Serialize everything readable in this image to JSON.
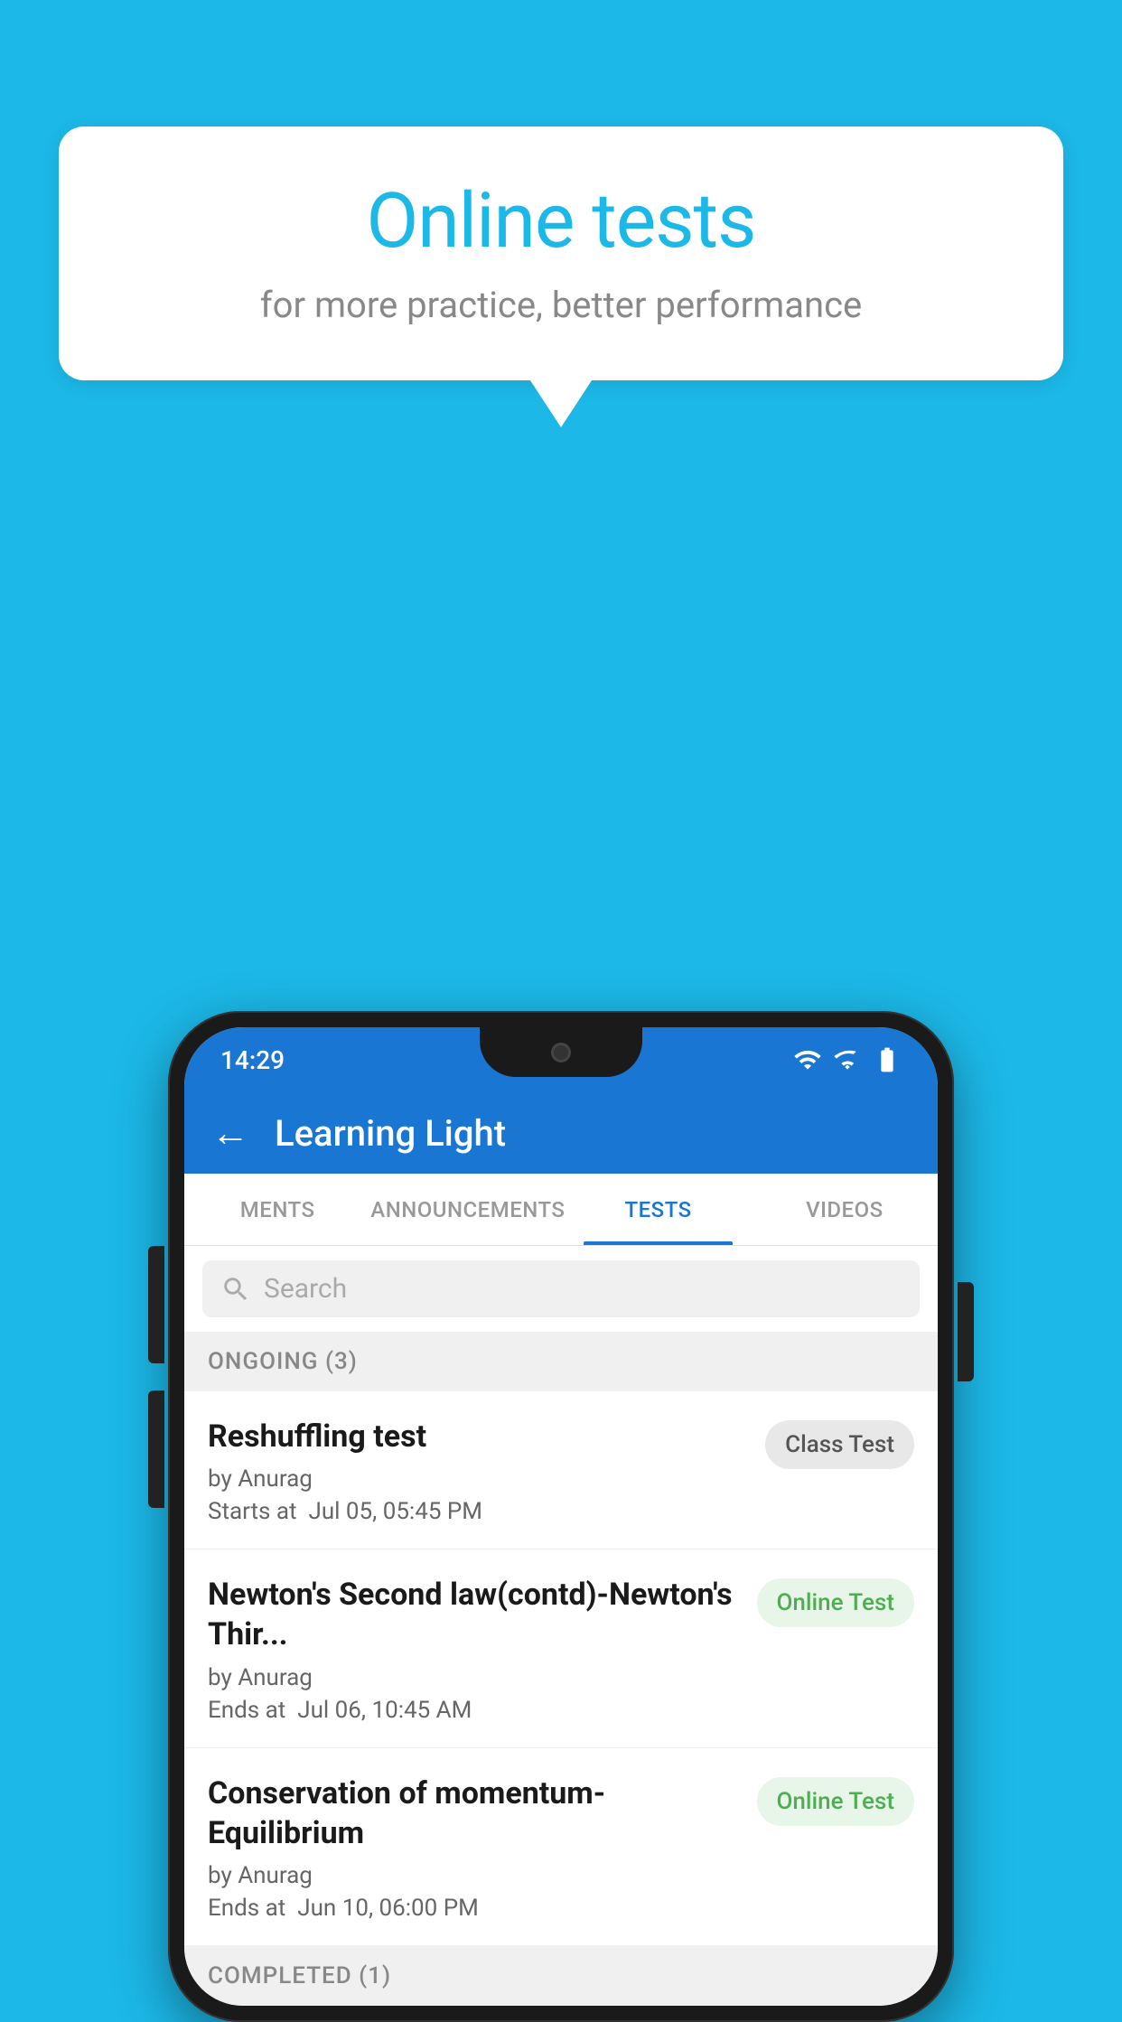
{
  "background": {
    "color": "#1cb8e8"
  },
  "bubble": {
    "title": "Online tests",
    "subtitle": "for more practice, better performance"
  },
  "status_bar": {
    "time": "14:29",
    "wifi_icon": "wifi-icon",
    "signal_icon": "signal-icon",
    "battery_icon": "battery-icon"
  },
  "app_header": {
    "back_label": "←",
    "title": "Learning Light"
  },
  "tabs": [
    {
      "label": "MENTS",
      "active": false
    },
    {
      "label": "ANNOUNCEMENTS",
      "active": false
    },
    {
      "label": "TESTS",
      "active": true
    },
    {
      "label": "VIDEOS",
      "active": false
    }
  ],
  "search": {
    "placeholder": "Search"
  },
  "ongoing_section": {
    "label": "ONGOING (3)"
  },
  "tests": [
    {
      "name": "Reshuffling test",
      "author": "by Anurag",
      "date_label": "Starts at",
      "date": "Jul 05, 05:45 PM",
      "badge": "Class Test",
      "badge_type": "class"
    },
    {
      "name": "Newton's Second law(contd)-Newton's Thir...",
      "author": "by Anurag",
      "date_label": "Ends at",
      "date": "Jul 06, 10:45 AM",
      "badge": "Online Test",
      "badge_type": "online"
    },
    {
      "name": "Conservation of momentum-Equilibrium",
      "author": "by Anurag",
      "date_label": "Ends at",
      "date": "Jun 10, 06:00 PM",
      "badge": "Online Test",
      "badge_type": "online"
    }
  ],
  "completed_section": {
    "label": "COMPLETED (1)"
  }
}
